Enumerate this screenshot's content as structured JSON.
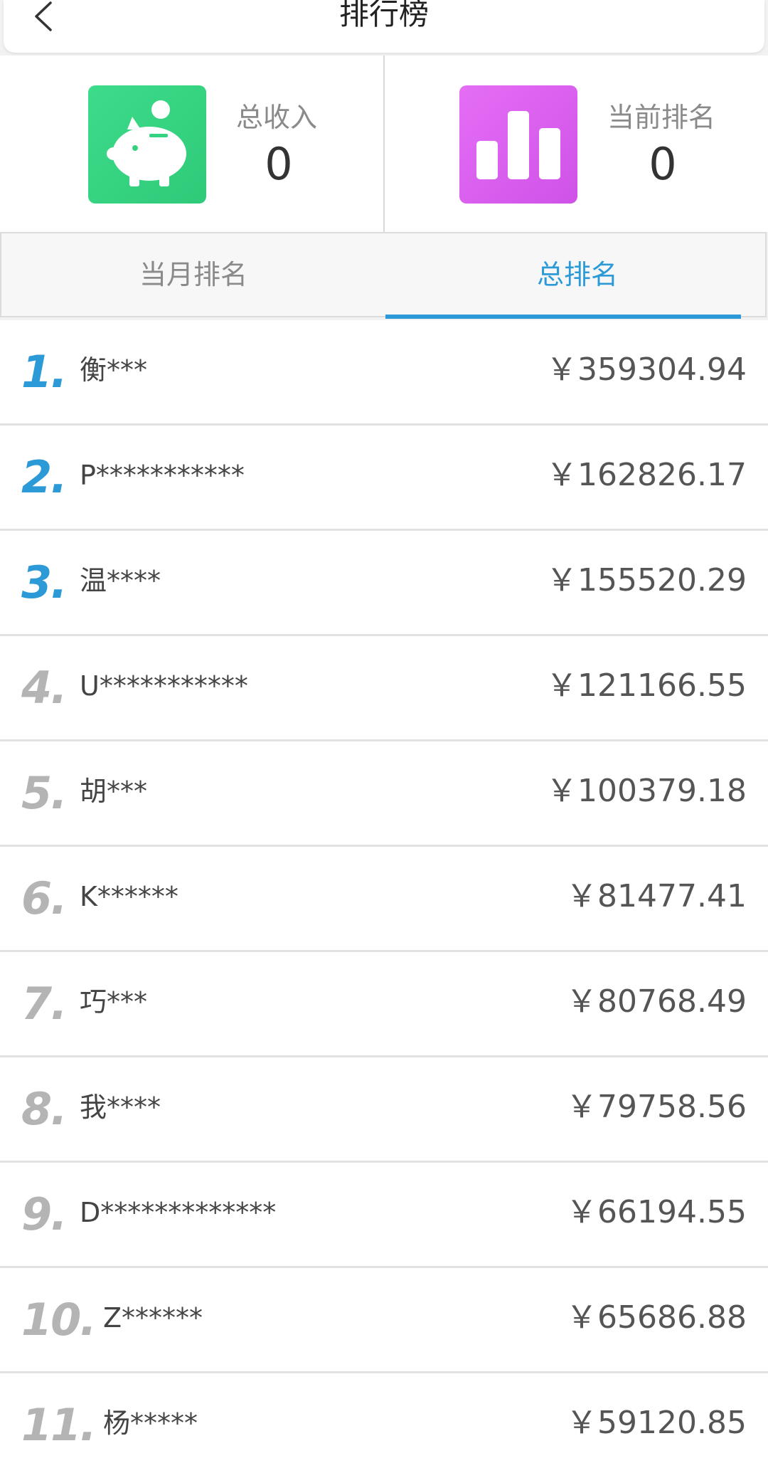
{
  "header": {
    "title": "排行榜"
  },
  "stats": {
    "total_income_label": "总收入",
    "total_income_value": "0",
    "current_rank_label": "当前排名",
    "current_rank_value": "0"
  },
  "tabs": [
    {
      "label": "当月排名",
      "active": false
    },
    {
      "label": "总排名",
      "active": true
    }
  ],
  "colors": {
    "accent": "#2c9ad6",
    "income_card": "#35d381",
    "rank_card": "#da5ff0",
    "rank_muted": "#b4b4b4"
  },
  "ranking": [
    {
      "rank": "1.",
      "name": "衡***",
      "amount": "￥359304.94"
    },
    {
      "rank": "2.",
      "name": "P***********",
      "amount": "￥162826.17"
    },
    {
      "rank": "3.",
      "name": "温****",
      "amount": "￥155520.29"
    },
    {
      "rank": "4.",
      "name": "U***********",
      "amount": "￥121166.55"
    },
    {
      "rank": "5.",
      "name": "胡***",
      "amount": "￥100379.18"
    },
    {
      "rank": "6.",
      "name": "K******",
      "amount": "￥81477.41"
    },
    {
      "rank": "7.",
      "name": "巧***",
      "amount": "￥80768.49"
    },
    {
      "rank": "8.",
      "name": "我****",
      "amount": "￥79758.56"
    },
    {
      "rank": "9.",
      "name": "D*************",
      "amount": "￥66194.55"
    },
    {
      "rank": "10.",
      "name": "Z******",
      "amount": "￥65686.88"
    },
    {
      "rank": "11.",
      "name": "杨*****",
      "amount": "￥59120.85"
    }
  ]
}
